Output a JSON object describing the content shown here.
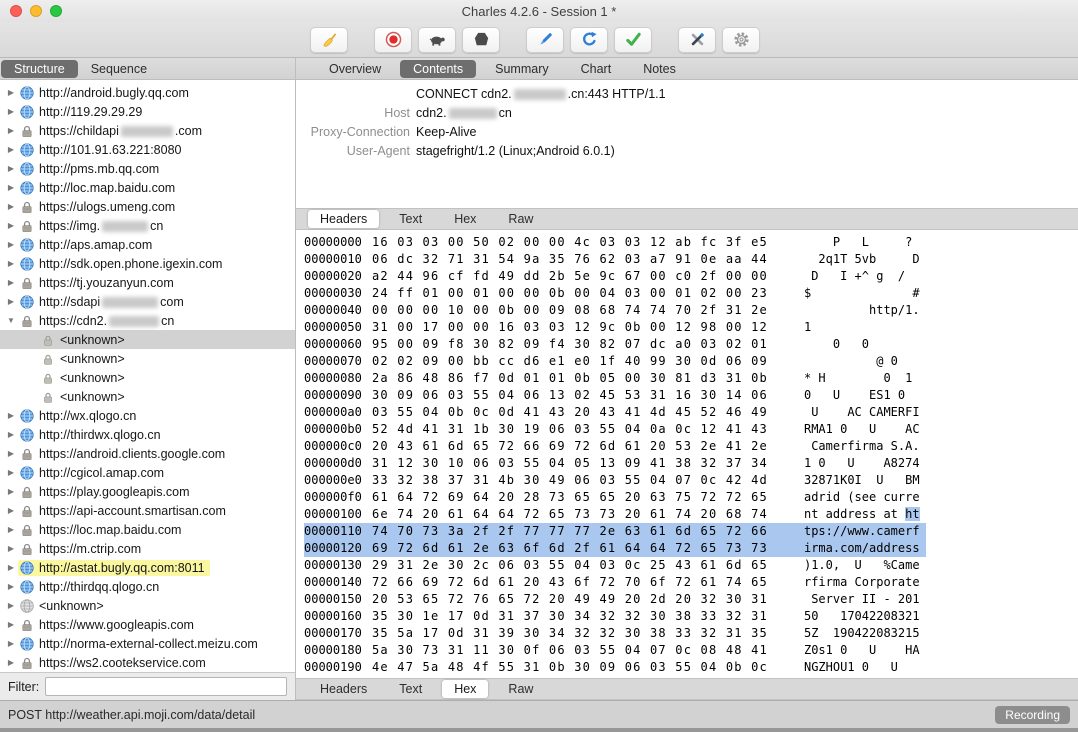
{
  "window": {
    "title": "Charles 4.2.6 - Session 1 *"
  },
  "toolbar": {
    "groups": [
      [
        "clear-session"
      ],
      [
        "record",
        "throttle",
        "breakpoints"
      ],
      [
        "compose",
        "repeat",
        "validate"
      ],
      [
        "tools",
        "settings"
      ]
    ]
  },
  "sidebar": {
    "tabs": [
      {
        "label": "Structure",
        "selected": true
      },
      {
        "label": "Sequence"
      }
    ],
    "filter_label": "Filter:",
    "filter_value": "",
    "tree": [
      {
        "icon": "globe",
        "arrow": "right",
        "seg": [
          {
            "t": "http://android.bugly.qq.com"
          }
        ]
      },
      {
        "icon": "globe",
        "arrow": "right",
        "seg": [
          {
            "t": "http://119.29.29.29"
          }
        ]
      },
      {
        "icon": "lock",
        "arrow": "right",
        "seg": [
          {
            "t": "https://childapi"
          },
          {
            "r": 52
          },
          {
            "t": ".com"
          }
        ]
      },
      {
        "icon": "globe",
        "arrow": "right",
        "seg": [
          {
            "t": "http://101.91.63.221:8080"
          }
        ]
      },
      {
        "icon": "globe",
        "arrow": "right",
        "seg": [
          {
            "t": "http://pms.mb.qq.com"
          }
        ]
      },
      {
        "icon": "globe",
        "arrow": "right",
        "seg": [
          {
            "t": "http://loc.map.baidu.com"
          }
        ]
      },
      {
        "icon": "lock",
        "arrow": "right",
        "seg": [
          {
            "t": "https://ulogs.umeng.com"
          }
        ]
      },
      {
        "icon": "lock",
        "arrow": "right",
        "seg": [
          {
            "t": "https://img."
          },
          {
            "r": 46
          },
          {
            "t": "cn"
          }
        ]
      },
      {
        "icon": "globe",
        "arrow": "right",
        "seg": [
          {
            "t": "http://aps.amap.com"
          }
        ]
      },
      {
        "icon": "globe",
        "arrow": "right",
        "seg": [
          {
            "t": "http://sdk.open.phone.igexin.com"
          }
        ]
      },
      {
        "icon": "lock",
        "arrow": "right",
        "seg": [
          {
            "t": "https://tj.youzanyun.com"
          }
        ]
      },
      {
        "icon": "globe",
        "arrow": "right",
        "seg": [
          {
            "t": "http://sdapi"
          },
          {
            "r": 56
          },
          {
            "t": "com"
          }
        ]
      },
      {
        "icon": "lock",
        "arrow": "down",
        "seg": [
          {
            "t": "https://cdn2."
          },
          {
            "r": 50
          },
          {
            "t": "cn"
          }
        ]
      },
      {
        "icon": "lock-small",
        "arrow": "none",
        "child": true,
        "selected": true,
        "seg": [
          {
            "t": "<unknown>"
          }
        ]
      },
      {
        "icon": "lock-small",
        "arrow": "none",
        "child": true,
        "seg": [
          {
            "t": "<unknown>"
          }
        ]
      },
      {
        "icon": "lock-small",
        "arrow": "none",
        "child": true,
        "seg": [
          {
            "t": "<unknown>"
          }
        ]
      },
      {
        "icon": "lock-small",
        "arrow": "none",
        "child": true,
        "seg": [
          {
            "t": "<unknown>"
          }
        ]
      },
      {
        "icon": "globe",
        "arrow": "right",
        "seg": [
          {
            "t": "http://wx.qlogo.cn"
          }
        ]
      },
      {
        "icon": "globe",
        "arrow": "right",
        "seg": [
          {
            "t": "http://thirdwx.qlogo.cn"
          }
        ]
      },
      {
        "icon": "lock",
        "arrow": "right",
        "seg": [
          {
            "t": "https://android.clients.google.com"
          }
        ]
      },
      {
        "icon": "globe",
        "arrow": "right",
        "seg": [
          {
            "t": "http://cgicol.amap.com"
          }
        ]
      },
      {
        "icon": "lock",
        "arrow": "right",
        "seg": [
          {
            "t": "https://play.googleapis.com"
          }
        ]
      },
      {
        "icon": "lock",
        "arrow": "right",
        "seg": [
          {
            "t": "https://api-account.smartisan.com"
          }
        ]
      },
      {
        "icon": "lock",
        "arrow": "right",
        "seg": [
          {
            "t": "https://loc.map.baidu.com"
          }
        ]
      },
      {
        "icon": "lock",
        "arrow": "right",
        "seg": [
          {
            "t": "https://m.ctrip.com"
          }
        ]
      },
      {
        "icon": "globe",
        "arrow": "right",
        "highlight": true,
        "seg": [
          {
            "t": "http://astat.bugly.qq.com:8011"
          }
        ]
      },
      {
        "icon": "globe",
        "arrow": "right",
        "seg": [
          {
            "t": "http://thirdqq.qlogo.cn"
          }
        ]
      },
      {
        "icon": "globe-gray",
        "arrow": "right",
        "seg": [
          {
            "t": "<unknown>"
          }
        ]
      },
      {
        "icon": "lock",
        "arrow": "right",
        "seg": [
          {
            "t": "https://www.googleapis.com"
          }
        ]
      },
      {
        "icon": "globe",
        "arrow": "right",
        "seg": [
          {
            "t": "http://norma-external-collect.meizu.com"
          }
        ]
      },
      {
        "icon": "lock",
        "arrow": "right",
        "seg": [
          {
            "t": "https://ws2.cootekservice.com"
          }
        ]
      }
    ]
  },
  "main": {
    "tabs": [
      {
        "label": "Overview"
      },
      {
        "label": "Contents",
        "selected": true
      },
      {
        "label": "Summary"
      },
      {
        "label": "Chart"
      },
      {
        "label": "Notes"
      }
    ],
    "request": {
      "line1": [
        {
          "t": "CONNECT cdn2."
        },
        {
          "r": 52
        },
        {
          "t": ".cn:443 HTTP/1.1"
        }
      ],
      "headers": [
        {
          "label": "Host",
          "value": [
            {
              "t": "cdn2."
            },
            {
              "r": 48
            },
            {
              "t": "cn"
            }
          ]
        },
        {
          "label": "Proxy-Connection",
          "value": [
            {
              "t": "Keep-Alive"
            }
          ]
        },
        {
          "label": "User-Agent",
          "value": [
            {
              "t": "stagefright/1.2 (Linux;Android 6.0.1)"
            }
          ]
        }
      ],
      "tabs": [
        {
          "label": "Headers",
          "selected": true
        },
        {
          "label": "Text"
        },
        {
          "label": "Hex"
        },
        {
          "label": "Raw"
        }
      ]
    },
    "response": {
      "tabs": [
        {
          "label": "Headers"
        },
        {
          "label": "Text"
        },
        {
          "label": "Hex",
          "selected": true
        },
        {
          "label": "Raw"
        }
      ],
      "hex_rows": [
        {
          "a": "00000000",
          "h": "16 03 03 00 50 02 00 00 4c 03 03 12 ab fc 3f e5",
          "t": "    P   L     ? "
        },
        {
          "a": "00000010",
          "h": "06 dc 32 71 31 54 9a 35 76 62 03 a7 91 0e aa 44",
          "t": "  2q1T 5vb     D"
        },
        {
          "a": "00000020",
          "h": "a2 44 96 cf fd 49 dd 2b 5e 9c 67 00 c0 2f 00 00",
          "t": " D   I +^ g  /  "
        },
        {
          "a": "00000030",
          "h": "24 ff 01 00 01 00 00 0b 00 04 03 00 01 02 00 23",
          "t": "$              #"
        },
        {
          "a": "00000040",
          "h": "00 00 00 10 00 0b 00 09 08 68 74 74 70 2f 31 2e",
          "t": "         http/1."
        },
        {
          "a": "00000050",
          "h": "31 00 17 00 00 16 03 03 12 9c 0b 00 12 98 00 12",
          "t": "1               "
        },
        {
          "a": "00000060",
          "h": "95 00 09 f8 30 82 09 f4 30 82 07 dc a0 03 02 01",
          "t": "    0   0       "
        },
        {
          "a": "00000070",
          "h": "02 02 09 00 bb cc d6 e1 e0 1f 40 99 30 0d 06 09",
          "t": "          @ 0   "
        },
        {
          "a": "00000080",
          "h": "2a 86 48 86 f7 0d 01 01 0b 05 00 30 81 d3 31 0b",
          "t": "* H        0  1 "
        },
        {
          "a": "00000090",
          "h": "30 09 06 03 55 04 06 13 02 45 53 31 16 30 14 06",
          "t": "0   U    ES1 0  "
        },
        {
          "a": "000000a0",
          "h": "03 55 04 0b 0c 0d 41 43 20 43 41 4d 45 52 46 49",
          "t": " U    AC CAMERFI"
        },
        {
          "a": "000000b0",
          "h": "52 4d 41 31 1b 30 19 06 03 55 04 0a 0c 12 41 43",
          "t": "RMA1 0   U    AC"
        },
        {
          "a": "000000c0",
          "h": "20 43 61 6d 65 72 66 69 72 6d 61 20 53 2e 41 2e",
          "t": " Camerfirma S.A."
        },
        {
          "a": "000000d0",
          "h": "31 12 30 10 06 03 55 04 05 13 09 41 38 32 37 34",
          "t": "1 0   U    A8274"
        },
        {
          "a": "000000e0",
          "h": "33 32 38 37 31 4b 30 49 06 03 55 04 07 0c 42 4d",
          "t": "32871K0I  U   BM"
        },
        {
          "a": "000000f0",
          "h": "61 64 72 69 64 20 28 73 65 65 20 63 75 72 72 65",
          "t": "adrid (see curre"
        },
        {
          "a": "00000100",
          "h": "6e 74 20 61 64 64 72 65 73 73 20 61 74 20 68 74",
          "t": "nt address at ht",
          "hl_tail": 2
        },
        {
          "a": "00000110",
          "h": "74 70 73 3a 2f 2f 77 77 77 2e 63 61 6d 65 72 66",
          "t": "tps://www.camerf",
          "sel": 2
        },
        {
          "a": "00000120",
          "h": "69 72 6d 61 2e 63 6f 6d 2f 61 64 64 72 65 73 73",
          "t": "irma.com/address",
          "sel": 2
        },
        {
          "a": "00000130",
          "h": "29 31 2e 30 2c 06 03 55 04 03 0c 25 43 61 6d 65",
          "t": ")1.0,  U   %Came"
        },
        {
          "a": "00000140",
          "h": "72 66 69 72 6d 61 20 43 6f 72 70 6f 72 61 74 65",
          "t": "rfirma Corporate"
        },
        {
          "a": "00000150",
          "h": "20 53 65 72 76 65 72 20 49 49 20 2d 20 32 30 31",
          "t": " Server II - 201"
        },
        {
          "a": "00000160",
          "h": "35 30 1e 17 0d 31 37 30 34 32 32 30 38 33 32 31",
          "t": "50   17042208321"
        },
        {
          "a": "00000170",
          "h": "35 5a 17 0d 31 39 30 34 32 32 30 38 33 32 31 35",
          "t": "5Z  190422083215"
        },
        {
          "a": "00000180",
          "h": "5a 30 73 31 11 30 0f 06 03 55 04 07 0c 08 48 41",
          "t": "Z0s1 0   U    HA"
        },
        {
          "a": "00000190",
          "h": "4e 47 5a 48 4f 55 31 0b 30 09 06 03 55 04 0b 0c",
          "t": "NGZHOU1 0   U   "
        }
      ]
    }
  },
  "statusbar": {
    "text": "POST http://weather.api.moji.com/data/detail",
    "badge": "Recording"
  },
  "colors": {
    "selection_blue": "#aac8ef",
    "row_selected_gray": "#d2d2d2",
    "highlight_yellow": "#faf7a0",
    "badge_gray": "#8d8d8d",
    "tab_selected_gray": "#6e6e6e"
  }
}
